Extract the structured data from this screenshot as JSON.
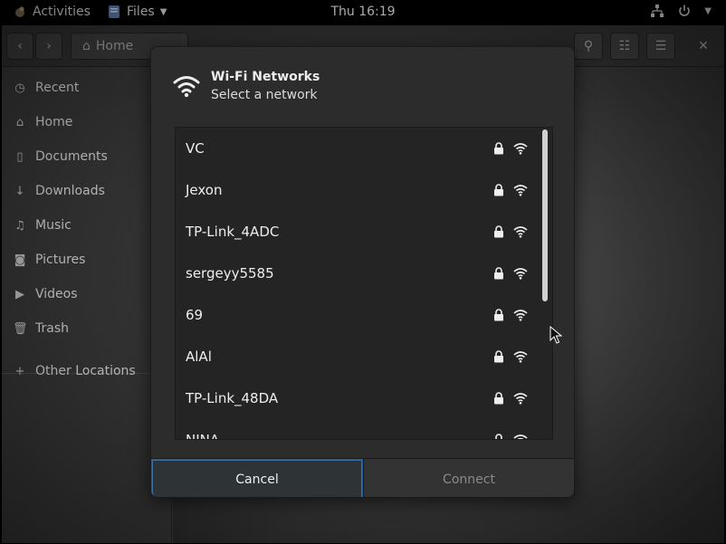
{
  "topbar": {
    "activities": "Activities",
    "app_menu": "Files",
    "clock": "Thu 16:19"
  },
  "files_window": {
    "location": "Home",
    "sidebar": [
      {
        "label": "Recent",
        "icon": "clock-icon"
      },
      {
        "label": "Home",
        "icon": "home-icon"
      },
      {
        "label": "Documents",
        "icon": "document-icon"
      },
      {
        "label": "Downloads",
        "icon": "download-icon"
      },
      {
        "label": "Music",
        "icon": "music-icon"
      },
      {
        "label": "Pictures",
        "icon": "camera-icon"
      },
      {
        "label": "Videos",
        "icon": "video-icon"
      },
      {
        "label": "Trash",
        "icon": "trash-icon"
      }
    ],
    "other_locations": "Other Locations"
  },
  "dialog": {
    "title": "Wi-Fi Networks",
    "subtitle": "Select a network",
    "networks": [
      {
        "name": "VC",
        "secured": true
      },
      {
        "name": "Jexon",
        "secured": true
      },
      {
        "name": "TP-Link_4ADC",
        "secured": true
      },
      {
        "name": "sergeyy5585",
        "secured": true
      },
      {
        "name": "69",
        "secured": true
      },
      {
        "name": "AlAl",
        "secured": true
      },
      {
        "name": "TP-Link_48DA",
        "secured": true
      },
      {
        "name": "NINA",
        "secured": true
      }
    ],
    "cancel_label": "Cancel",
    "connect_label": "Connect"
  },
  "colors": {
    "dialog_bg": "#2c2c2c",
    "list_bg": "#242424",
    "focus_border": "#3b6ea5",
    "disabled_text": "#8a8a8a"
  }
}
